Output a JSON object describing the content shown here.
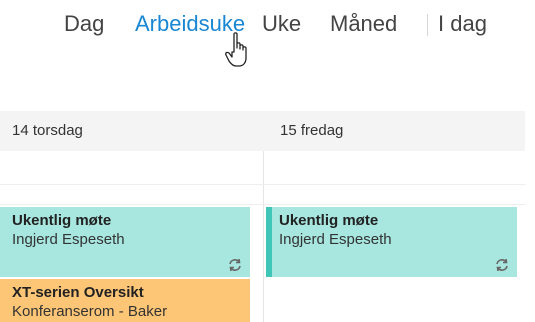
{
  "views": {
    "day": "Dag",
    "work_week": "Arbeidsuke",
    "week": "Uke",
    "month": "Måned",
    "today": "I dag",
    "active": "Arbeidsuke"
  },
  "days": [
    {
      "label": "14 torsdag"
    },
    {
      "label": "15 fredag"
    }
  ],
  "events": [
    {
      "title": "Ukentlig møte",
      "subtitle": "Ingjerd Espeseth",
      "color": "#a7e7e0",
      "recurring": true
    },
    {
      "title": "Ukentlig møte",
      "subtitle": "Ingjerd Espeseth",
      "color": "#a7e7e0",
      "recurring": true,
      "selected": true
    },
    {
      "title": "XT-serien Oversikt",
      "subtitle": "Konferanserom - Baker",
      "color": "#fdc676"
    }
  ],
  "colors": {
    "accent": "#1a87d4",
    "teal": "#a7e7e0",
    "teal_bar": "#3fc6b8",
    "orange": "#fdc676"
  },
  "icons": {
    "cursor": "hand-pointer-icon",
    "recurring": "recurring-icon"
  }
}
